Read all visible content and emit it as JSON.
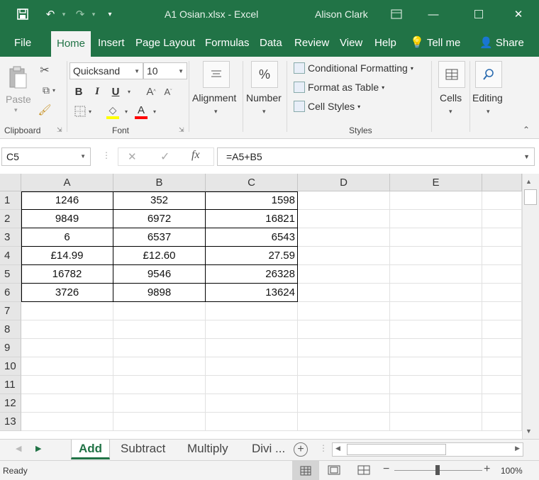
{
  "titlebar": {
    "title": "A1 Osian.xlsx  -  Excel",
    "user": "Alison Clark"
  },
  "tabs": [
    "File",
    "Home",
    "Insert",
    "Page Layout",
    "Formulas",
    "Data",
    "Review",
    "View",
    "Help",
    "Tell me",
    "Share"
  ],
  "ribbon": {
    "paste_label": "Paste",
    "font_name": "Quicksand",
    "font_size": "10",
    "bold": "B",
    "italic": "I",
    "underline": "U",
    "alignment": "Alignment",
    "number": "Number",
    "percent": "%",
    "conditional_formatting": "Conditional Formatting",
    "format_as_table": "Format as Table",
    "cell_styles": "Cell Styles",
    "cells": "Cells",
    "editing": "Editing",
    "groups": {
      "clipboard": "Clipboard",
      "font": "Font",
      "styles": "Styles"
    }
  },
  "formula_bar": {
    "name_box": "C5",
    "fx": "fx",
    "formula": "=A5+B5"
  },
  "grid": {
    "columns": [
      "A",
      "B",
      "C",
      "D",
      "E"
    ],
    "rows": [
      "1",
      "2",
      "3",
      "4",
      "5",
      "6",
      "7",
      "8",
      "9",
      "10",
      "11",
      "12",
      "13"
    ],
    "cells": [
      [
        "1246",
        "352",
        "1598"
      ],
      [
        "9849",
        "6972",
        "16821"
      ],
      [
        "6",
        "6537",
        "6543"
      ],
      [
        "£14.99",
        "£12.60",
        "27.59"
      ],
      [
        "16782",
        "9546",
        "26328"
      ],
      [
        "3726",
        "9898",
        "13624"
      ]
    ]
  },
  "sheets": [
    "Add",
    "Subtract",
    "Multiply",
    "Divi ..."
  ],
  "status": {
    "ready": "Ready",
    "zoom": "100%"
  },
  "colors": {
    "brand": "#217346",
    "font_color_bar": "#ff0000",
    "highlight_bar": "#ffff00"
  }
}
